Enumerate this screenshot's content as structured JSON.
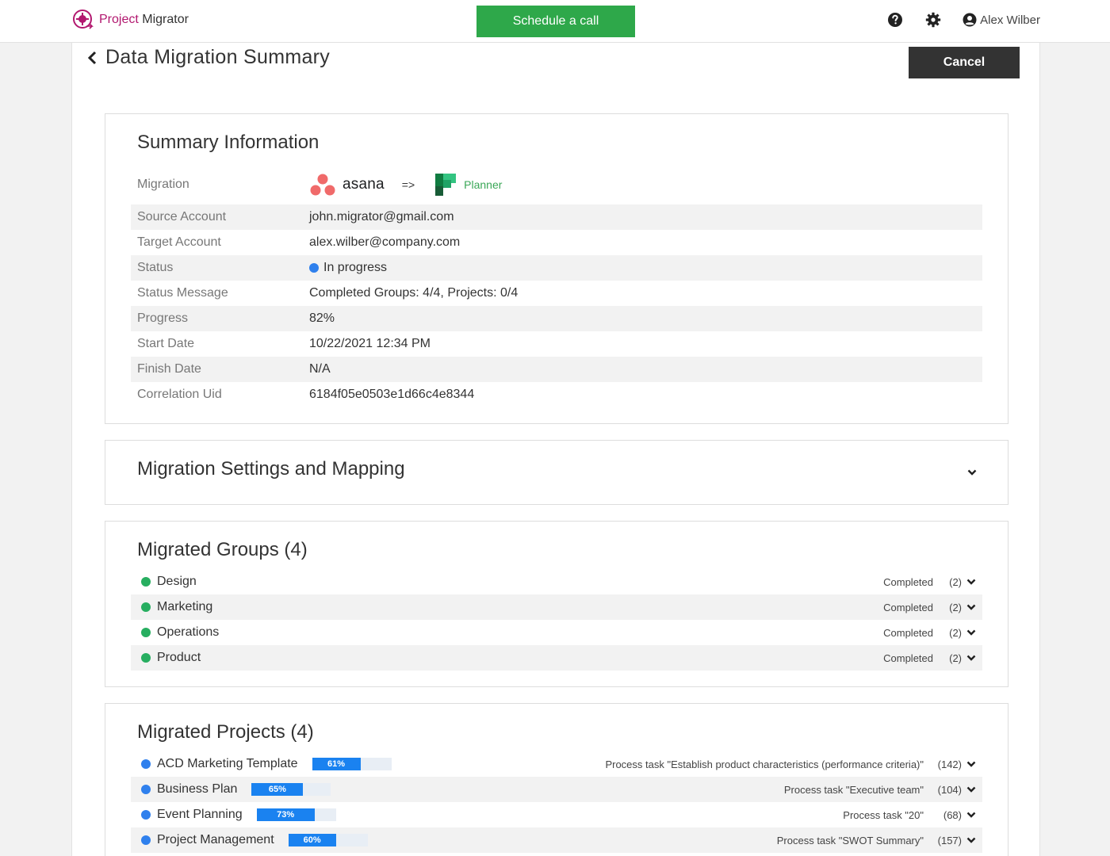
{
  "brand": {
    "part1": "Project",
    "part2": "Migrator"
  },
  "header": {
    "schedule_label": "Schedule a call",
    "user_name": "Alex Wilber"
  },
  "page": {
    "title": "Data Migration Summary",
    "cancel_label": "Cancel"
  },
  "summary": {
    "title": "Summary Information",
    "migration_label": "Migration",
    "source_logo_text": "asana",
    "arrow": "=>",
    "target_logo_text": "Planner",
    "rows": [
      {
        "label": "Source Account",
        "value": "john.migrator@gmail.com"
      },
      {
        "label": "Target Account",
        "value": "alex.wilber@company.com"
      },
      {
        "label": "Status",
        "value": "In progress"
      },
      {
        "label": "Status Message",
        "value": "Completed Groups: 4/4, Projects: 0/4"
      },
      {
        "label": "Progress",
        "value": "82%"
      },
      {
        "label": "Start Date",
        "value": "10/22/2021 12:34 PM"
      },
      {
        "label": "Finish Date",
        "value": "N/A"
      },
      {
        "label": "Correlation Uid",
        "value": "6184f05e0503e1d66c4e8344"
      }
    ]
  },
  "settings": {
    "title": "Migration Settings and Mapping"
  },
  "groups": {
    "title": "Migrated Groups (4)",
    "items": [
      {
        "name": "Design",
        "status": "Completed",
        "count": "(2)"
      },
      {
        "name": "Marketing",
        "status": "Completed",
        "count": "(2)"
      },
      {
        "name": "Operations",
        "status": "Completed",
        "count": "(2)"
      },
      {
        "name": "Product",
        "status": "Completed",
        "count": "(2)"
      }
    ]
  },
  "projects": {
    "title": "Migrated Projects (4)",
    "items": [
      {
        "name": "ACD Marketing Template",
        "progress_label": "61%",
        "progress": 0.61,
        "status": "Process task \"Establish product characteristics (performance criteria)\"",
        "count": "(142)"
      },
      {
        "name": "Business Plan",
        "progress_label": "65%",
        "progress": 0.65,
        "status": "Process task \"Executive team\"",
        "count": "(104)"
      },
      {
        "name": "Event Planning",
        "progress_label": "73%",
        "progress": 0.73,
        "status": "Process task \"20\"",
        "count": "(68)"
      },
      {
        "name": "Project Management",
        "progress_label": "60%",
        "progress": 0.6,
        "status": "Process task \"SWOT Summary\"",
        "count": "(157)"
      }
    ]
  },
  "colors": {
    "brand_accent": "#b2186f",
    "schedule_green": "#2ea84a",
    "status_blue": "#2f80ed",
    "status_green": "#27ae60",
    "progress_blue": "#1a82f0"
  },
  "icons": {
    "help": "question-circle-icon",
    "settings": "gear-icon",
    "user": "user-circle-icon",
    "back": "chevron-left-icon",
    "expand": "chevron-down-icon"
  }
}
